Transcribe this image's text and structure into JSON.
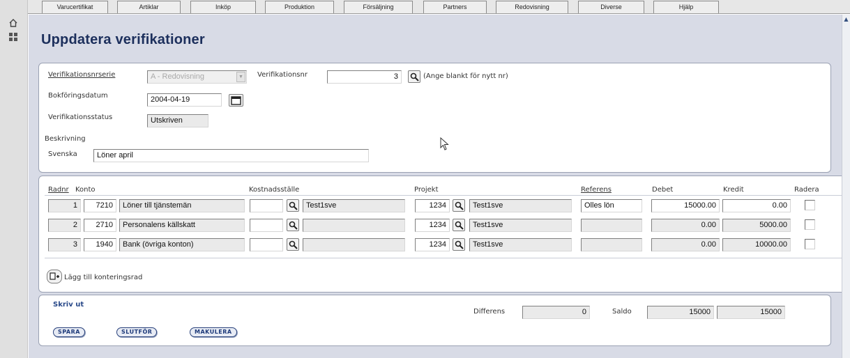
{
  "tabs": [
    {
      "label": "Varucertifikat"
    },
    {
      "label": "Artiklar"
    },
    {
      "label": "Inköp"
    },
    {
      "label": "Produktion"
    },
    {
      "label": "Försäljning"
    },
    {
      "label": "Partners"
    },
    {
      "label": "Redovisning"
    },
    {
      "label": "Diverse"
    },
    {
      "label": "Hjälp"
    }
  ],
  "page": {
    "title": "Uppdatera verifikationer"
  },
  "form": {
    "series_label": "Verifikationsnrserie",
    "series_value": "A - Redovisning",
    "vernr_label": "Verifikationsnr",
    "vernr_value": "3",
    "vernr_hint": "(Ange blankt för nytt nr)",
    "date_label": "Bokföringsdatum",
    "date_value": "2004-04-19",
    "status_label": "Verifikationsstatus",
    "status_value": "Utskriven",
    "desc_label": "Beskrivning",
    "desc_lang": "Svenska",
    "desc_value": "Löner april"
  },
  "table": {
    "headers": {
      "radnr": "Radnr",
      "konto": "Konto",
      "kostnadsstalle": "Kostnadsställe",
      "projekt": "Projekt",
      "referens": "Referens",
      "debet": "Debet",
      "kredit": "Kredit",
      "radera": "Radera"
    },
    "rows": [
      {
        "radnr": "1",
        "konto": "7210",
        "konto_name": "Löner till tjänstemän",
        "kst": "",
        "kst_name": "Test1sve",
        "projekt": "1234",
        "projekt_name": "Test1sve",
        "referens": "Olles lön",
        "debet": "15000.00",
        "kredit": "0.00"
      },
      {
        "radnr": "2",
        "konto": "2710",
        "konto_name": "Personalens källskatt",
        "kst": "",
        "kst_name": "",
        "projekt": "1234",
        "projekt_name": "Test1sve",
        "referens": "",
        "debet": "0.00",
        "kredit": "5000.00"
      },
      {
        "radnr": "3",
        "konto": "1940",
        "konto_name": "Bank (övriga konton)",
        "kst": "",
        "kst_name": "",
        "projekt": "1234",
        "projekt_name": "Test1sve",
        "referens": "",
        "debet": "0.00",
        "kredit": "10000.00"
      }
    ],
    "add_row_label": "Lägg till konteringsrad"
  },
  "footer": {
    "print_label": "Skriv ut",
    "differens_label": "Differens",
    "differens_value": "0",
    "saldo_label": "Saldo",
    "saldo_debet": "15000",
    "saldo_kredit": "15000",
    "buttons": {
      "save": "SPARA",
      "finish": "SLUTFÖR",
      "cancel": "MAKULERA"
    }
  },
  "colors": {
    "title": "#1c2f5c",
    "panel_bg": "#d8dbe6",
    "link": "#2a4a8a"
  },
  "icons": [
    "home-icon",
    "grid-icon",
    "search-icon",
    "calendar-icon",
    "add-row-icon",
    "mouse-cursor-icon",
    "scroll-up-icon"
  ]
}
